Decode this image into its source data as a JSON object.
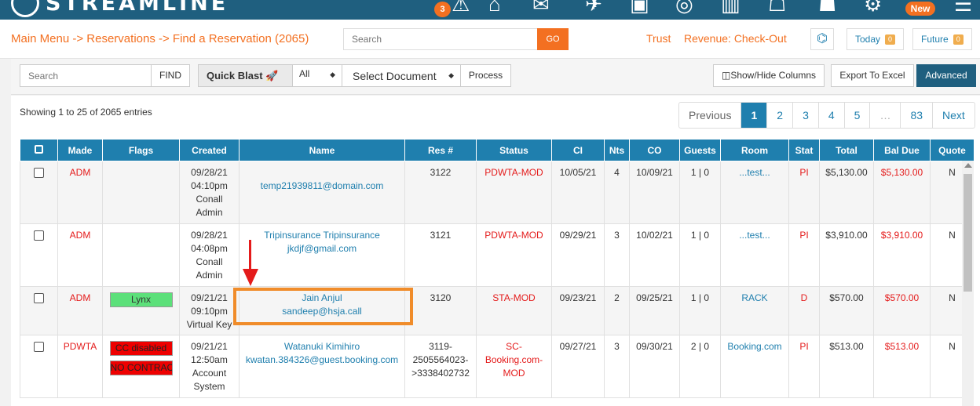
{
  "app": {
    "logo_text": "STREAMLINE",
    "alert_count": "3",
    "new_label": "New"
  },
  "nav_icons": [
    "alert-icon",
    "home-icon",
    "mail-icon",
    "plane-icon",
    "tag-icon",
    "compass-icon",
    "bar-chart-icon",
    "users-icon",
    "user-icon",
    "gear-icon",
    "user-group-icon"
  ],
  "header": {
    "breadcrumb": "Main Menu -> Reservations -> Find a Reservation (2065)",
    "search_placeholder": "Search",
    "go_label": "GO",
    "trust_label": "Trust",
    "revenue_label": "Revenue: Check-Out",
    "today_label": "Today",
    "today_count": "0",
    "future_label": "Future",
    "future_count": "0"
  },
  "toolbar": {
    "search_placeholder": "Search",
    "find_label": "FIND",
    "quick_blast_label": "Quick Blast",
    "all_select": "All",
    "document_select": "Select Document",
    "process_label": "Process",
    "show_hide_label": "Show/Hide Columns",
    "export_label": "Export To Excel",
    "advanced_label": "Advanced"
  },
  "listing": {
    "showing": "Showing 1 to 25 of 2065 entries",
    "pages": [
      "Previous",
      "1",
      "2",
      "3",
      "4",
      "5",
      "…",
      "83",
      "Next"
    ]
  },
  "table": {
    "columns": [
      "Made",
      "Flags",
      "Created",
      "Name",
      "Res #",
      "Status",
      "CI",
      "Nts",
      "CO",
      "Guests",
      "Room",
      "Stat",
      "Total",
      "Bal Due",
      "Quote"
    ],
    "rows": [
      {
        "made": "ADM",
        "flags": [],
        "created": [
          "09/28/21",
          "04:10pm",
          "Conall",
          "Admin"
        ],
        "name": [
          "temp21939811@domain.com"
        ],
        "res": [
          "3122"
        ],
        "status": [
          "PDWTA-MOD"
        ],
        "ci": "10/05/21",
        "nts": "4",
        "co": "10/09/21",
        "guests": "1 | 0",
        "room": "...test...",
        "stat": "PI",
        "total": "$5,130.00",
        "bal_due": "$5,130.00",
        "quote": "N"
      },
      {
        "made": "ADM",
        "flags": [],
        "created": [
          "09/28/21",
          "04:08pm",
          "Conall",
          "Admin"
        ],
        "name": [
          "Tripinsurance Tripinsurance",
          "jkdjf@gmail.com"
        ],
        "res": [
          "3121"
        ],
        "status": [
          "PDWTA-MOD"
        ],
        "ci": "09/29/21",
        "nts": "3",
        "co": "10/02/21",
        "guests": "1 | 0",
        "room": "...test...",
        "stat": "PI",
        "total": "$3,910.00",
        "bal_due": "$3,910.00",
        "quote": "N"
      },
      {
        "made": "ADM",
        "flags": [
          "Lynx"
        ],
        "created": [
          "09/21/21",
          "09:10pm",
          "Virtual Key"
        ],
        "name": [
          "Jain Anjul",
          "sandeep@hsja.call"
        ],
        "res": [
          "3120"
        ],
        "status": [
          "STA-MOD"
        ],
        "ci": "09/23/21",
        "nts": "2",
        "co": "09/25/21",
        "guests": "1 | 0",
        "room": "RACK",
        "stat": "D",
        "total": "$570.00",
        "bal_due": "$570.00",
        "quote": "N"
      },
      {
        "made": "PDWTA",
        "flags": [
          "CC disabled",
          "NO CONTRACT"
        ],
        "created": [
          "09/21/21",
          "12:50am",
          "Account",
          "System"
        ],
        "name": [
          "Watanuki Kimihiro",
          "kwatan.384326@guest.booking.com"
        ],
        "res": [
          "3119-",
          "2505564023-",
          ">3338402732"
        ],
        "status": [
          "SC-",
          "Booking.com-",
          "MOD"
        ],
        "ci": "09/27/21",
        "nts": "3",
        "co": "09/30/21",
        "guests": "2 | 0",
        "room": "Booking.com",
        "stat": "PI",
        "total": "$513.00",
        "bal_due": "$513.00",
        "quote": "N"
      }
    ]
  },
  "colors": {
    "primary": "#1f7fae",
    "topbar": "#1f5f7f",
    "accent": "#f37021",
    "danger": "#e41b1b"
  }
}
